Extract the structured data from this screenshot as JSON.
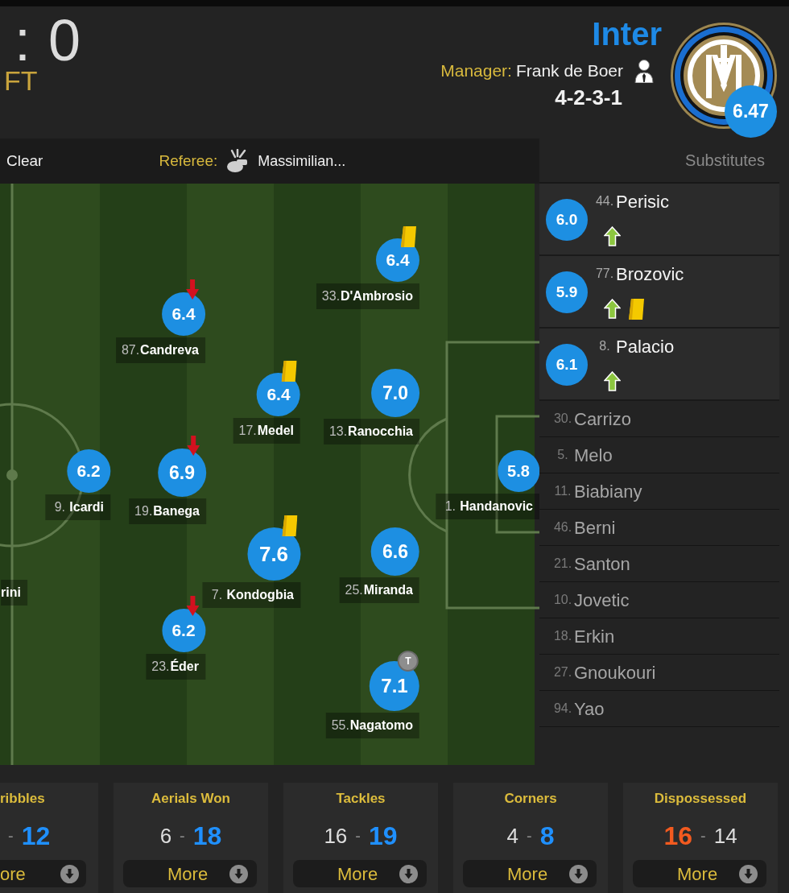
{
  "header": {
    "score_separator": ":",
    "score": "0",
    "status": "FT",
    "team": {
      "name": "Inter",
      "manager_label": "Manager:",
      "manager": "Frank de Boer",
      "formation": "4-2-3-1",
      "rating": "6.47"
    }
  },
  "pitch_toolbar": {
    "clear": "Clear",
    "referee_label": "Referee:",
    "referee": "Massimilian..."
  },
  "pitch": {
    "players": [
      {
        "number": "33.",
        "name": "D'Ambrosio",
        "rating": "6.4",
        "yellow_card": true,
        "subbed_off": false
      },
      {
        "number": "87.",
        "name": "Candreva",
        "rating": "6.4",
        "yellow_card": false,
        "subbed_off": true
      },
      {
        "number": "17.",
        "name": "Medel",
        "rating": "6.4",
        "yellow_card": true,
        "subbed_off": false
      },
      {
        "number": "13.",
        "name": "Ranocchia",
        "rating": "7.0",
        "yellow_card": false,
        "subbed_off": false
      },
      {
        "number": "9.",
        "name": "Icardi",
        "rating": "6.2",
        "yellow_card": false,
        "subbed_off": false
      },
      {
        "number": "19.",
        "name": "Banega",
        "rating": "6.9",
        "yellow_card": false,
        "subbed_off": true
      },
      {
        "number": "1.",
        "name": "Handanovic",
        "rating": "5.8",
        "yellow_card": false,
        "subbed_off": false
      },
      {
        "number": "7.",
        "name": "Kondogbia",
        "rating": "7.6",
        "yellow_card": true,
        "subbed_off": false
      },
      {
        "number": "25.",
        "name": "Miranda",
        "rating": "6.6",
        "yellow_card": false,
        "subbed_off": false
      },
      {
        "number": "23.",
        "name": "Éder",
        "rating": "6.2",
        "yellow_card": false,
        "subbed_off": true
      },
      {
        "number": "55.",
        "name": "Nagatomo",
        "rating": "7.1",
        "badge": "T",
        "yellow_card": false,
        "subbed_off": false
      },
      {
        "name": "rini",
        "yellow_card": false,
        "subbed_off": false
      }
    ]
  },
  "substitutes": {
    "title": "Substitutes",
    "played": [
      {
        "number": "44.",
        "name": "Perisic",
        "rating": "6.0",
        "subbed_on": true,
        "yellow_card": false
      },
      {
        "number": "77.",
        "name": "Brozovic",
        "rating": "5.9",
        "subbed_on": true,
        "yellow_card": true
      },
      {
        "number": "8.",
        "name": "Palacio",
        "rating": "6.1",
        "subbed_on": true,
        "yellow_card": false
      }
    ],
    "unused": [
      {
        "number": "30.",
        "name": "Carrizo"
      },
      {
        "number": "5.",
        "name": "Melo"
      },
      {
        "number": "11.",
        "name": "Biabiany"
      },
      {
        "number": "46.",
        "name": "Berni"
      },
      {
        "number": "21.",
        "name": "Santon"
      },
      {
        "number": "10.",
        "name": "Jovetic"
      },
      {
        "number": "18.",
        "name": "Erkin"
      },
      {
        "number": "27.",
        "name": "Gnoukouri"
      },
      {
        "number": "94.",
        "name": "Yao"
      }
    ]
  },
  "stats": [
    {
      "kind": "partial",
      "title": "ribbles",
      "separator": "-",
      "away": {
        "value": "12",
        "highlighted": true
      },
      "more": "ore"
    },
    {
      "kind": "full",
      "title": "Aerials Won",
      "home": {
        "value": "6",
        "highlighted": false
      },
      "separator": "-",
      "away": {
        "value": "18",
        "highlighted": true
      },
      "more": "More"
    },
    {
      "kind": "full",
      "title": "Tackles",
      "home": {
        "value": "16",
        "highlighted": false
      },
      "separator": "-",
      "away": {
        "value": "19",
        "highlighted": true
      },
      "more": "More"
    },
    {
      "kind": "full",
      "title": "Corners",
      "home": {
        "value": "4",
        "highlighted": false
      },
      "separator": "-",
      "away": {
        "value": "8",
        "highlighted": true
      },
      "more": "More"
    },
    {
      "kind": "full",
      "title": "Dispossessed",
      "home": {
        "value": "16",
        "highlighted": true
      },
      "separator": "-",
      "away": {
        "value": "14",
        "highlighted": false
      },
      "more": "More"
    }
  ]
}
